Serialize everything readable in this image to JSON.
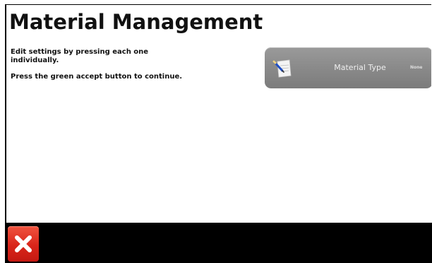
{
  "screen": {
    "title": "Material Management"
  },
  "instructions": {
    "line1": "Edit settings by pressing each one individually.",
    "line2": "Press the green accept button to continue."
  },
  "settings": [
    {
      "label": "Material Type",
      "value": "None",
      "icon": "notepad-pencil-icon"
    }
  ],
  "footer": {
    "cancel_icon": "close-icon",
    "cancel_color": "#d9251a"
  },
  "colors": {
    "setting_button_bg": "#8a8a8a",
    "bottom_bar_bg": "#000000"
  }
}
